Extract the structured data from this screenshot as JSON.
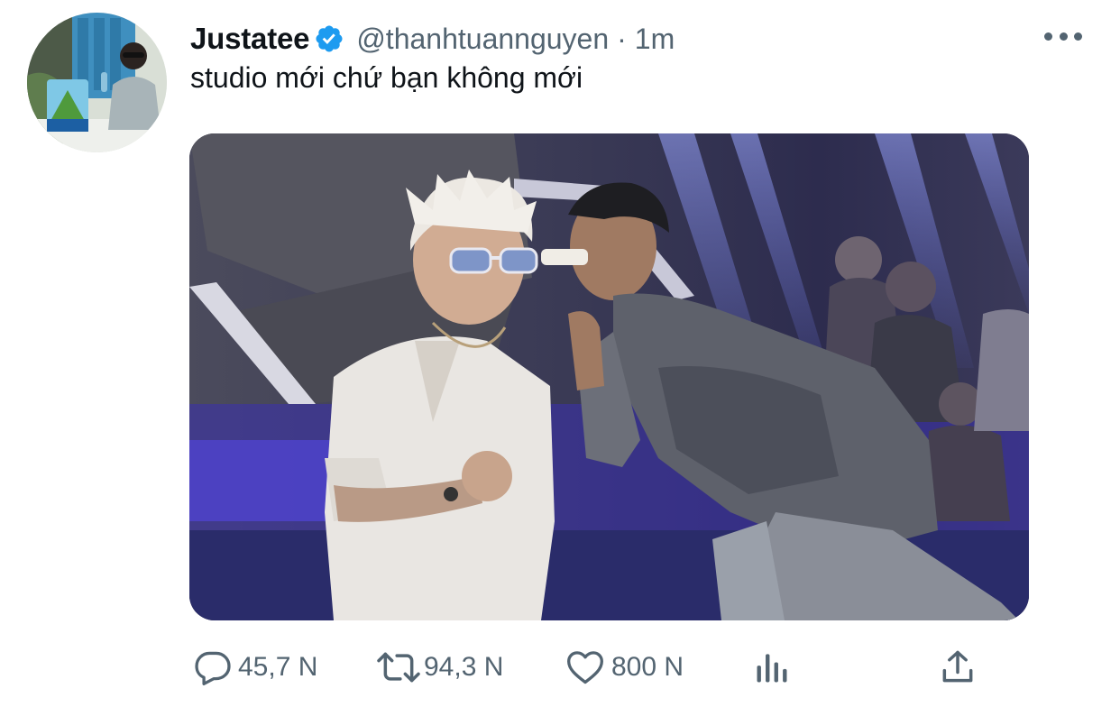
{
  "tweet": {
    "author": {
      "display_name": "Justatee",
      "handle": "@thanhtuannguyen",
      "verified": true
    },
    "separator": "·",
    "time": "1m",
    "text": "studio mới chứ bạn không mới",
    "actions": {
      "reply_count": "45,7 N",
      "retweet_count": "94,3 N",
      "like_count": "800 N"
    }
  },
  "icons": {
    "verified": "verified-badge-icon",
    "more": "more-options-icon",
    "reply": "reply-icon",
    "retweet": "retweet-icon",
    "like": "heart-icon",
    "views": "analytics-icon",
    "share": "share-icon"
  },
  "colors": {
    "text_primary": "#0f1419",
    "text_secondary": "#536471",
    "verified_blue": "#1d9bf0"
  }
}
